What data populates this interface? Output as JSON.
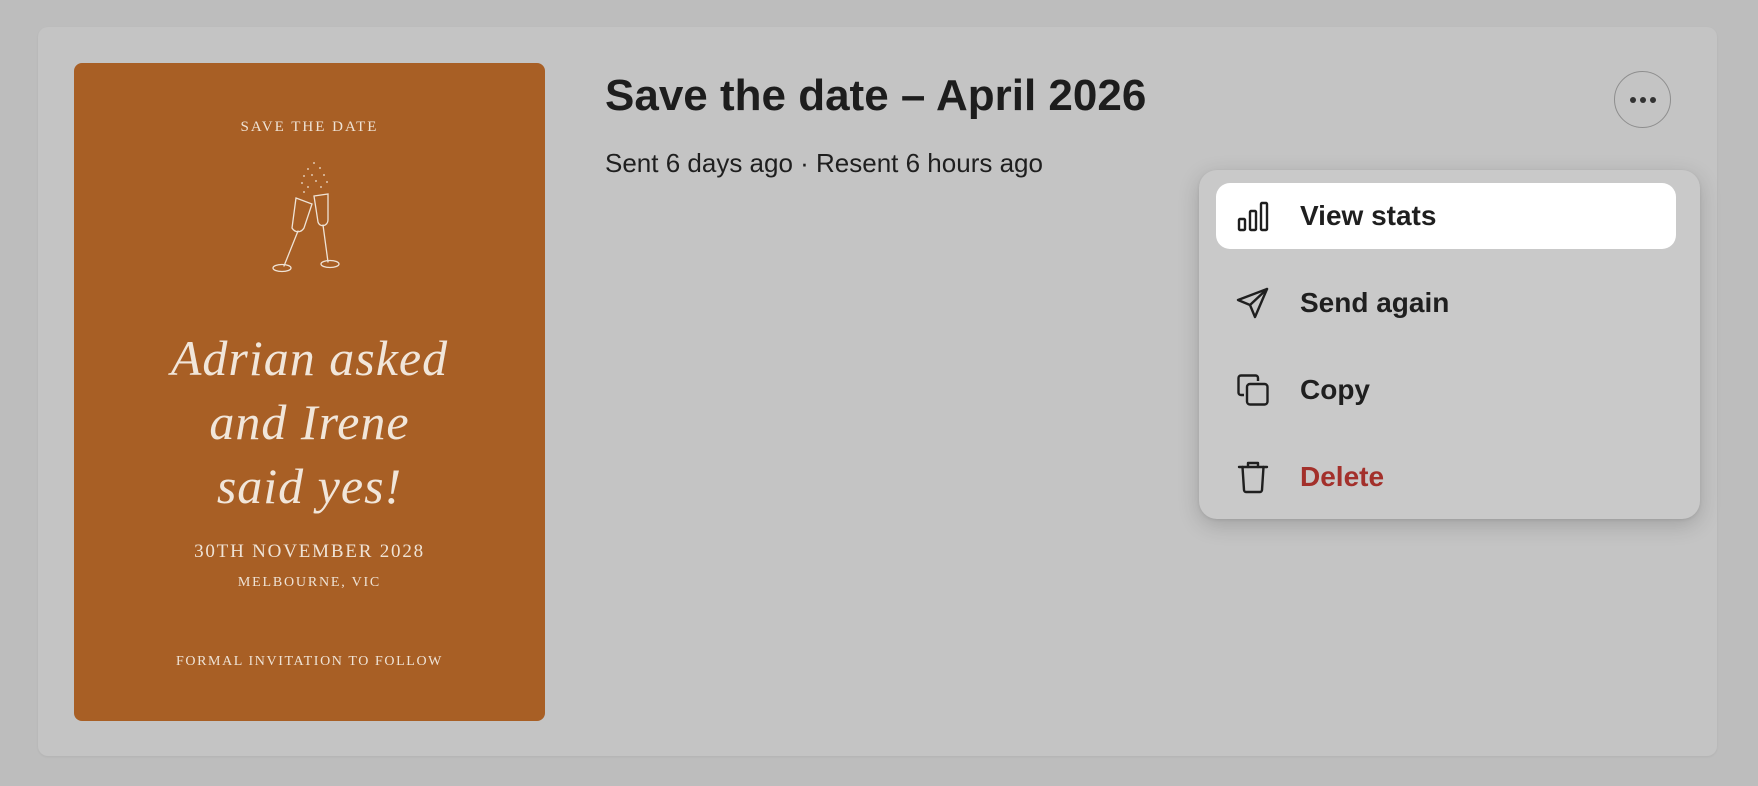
{
  "invite": {
    "top_line": "SAVE THE DATE",
    "script_lines": [
      "Adrian asked",
      "and Irene",
      "said yes!"
    ],
    "date": "30TH NOVEMBER 2028",
    "place": "MELBOURNE, VIC",
    "follow": "FORMAL INVITATION TO FOLLOW",
    "color": "#a85f25"
  },
  "header": {
    "title": "Save the date – April 2026",
    "subtitle": "Sent 6 days ago · Resent 6 hours ago"
  },
  "menu": {
    "items": [
      {
        "label": "View stats",
        "icon": "bar-chart-icon",
        "active": true
      },
      {
        "label": "Send again",
        "icon": "paper-plane-icon",
        "active": false
      },
      {
        "label": "Copy",
        "icon": "copy-icon",
        "active": false
      },
      {
        "label": "Delete",
        "icon": "trash-icon",
        "active": false,
        "color": "#a3302b"
      }
    ]
  },
  "colors": {
    "page_bg": "#bdbdbd",
    "card_bg": "#c4c4c4",
    "menu_bg": "#c9c9c9",
    "danger": "#a3302b"
  }
}
